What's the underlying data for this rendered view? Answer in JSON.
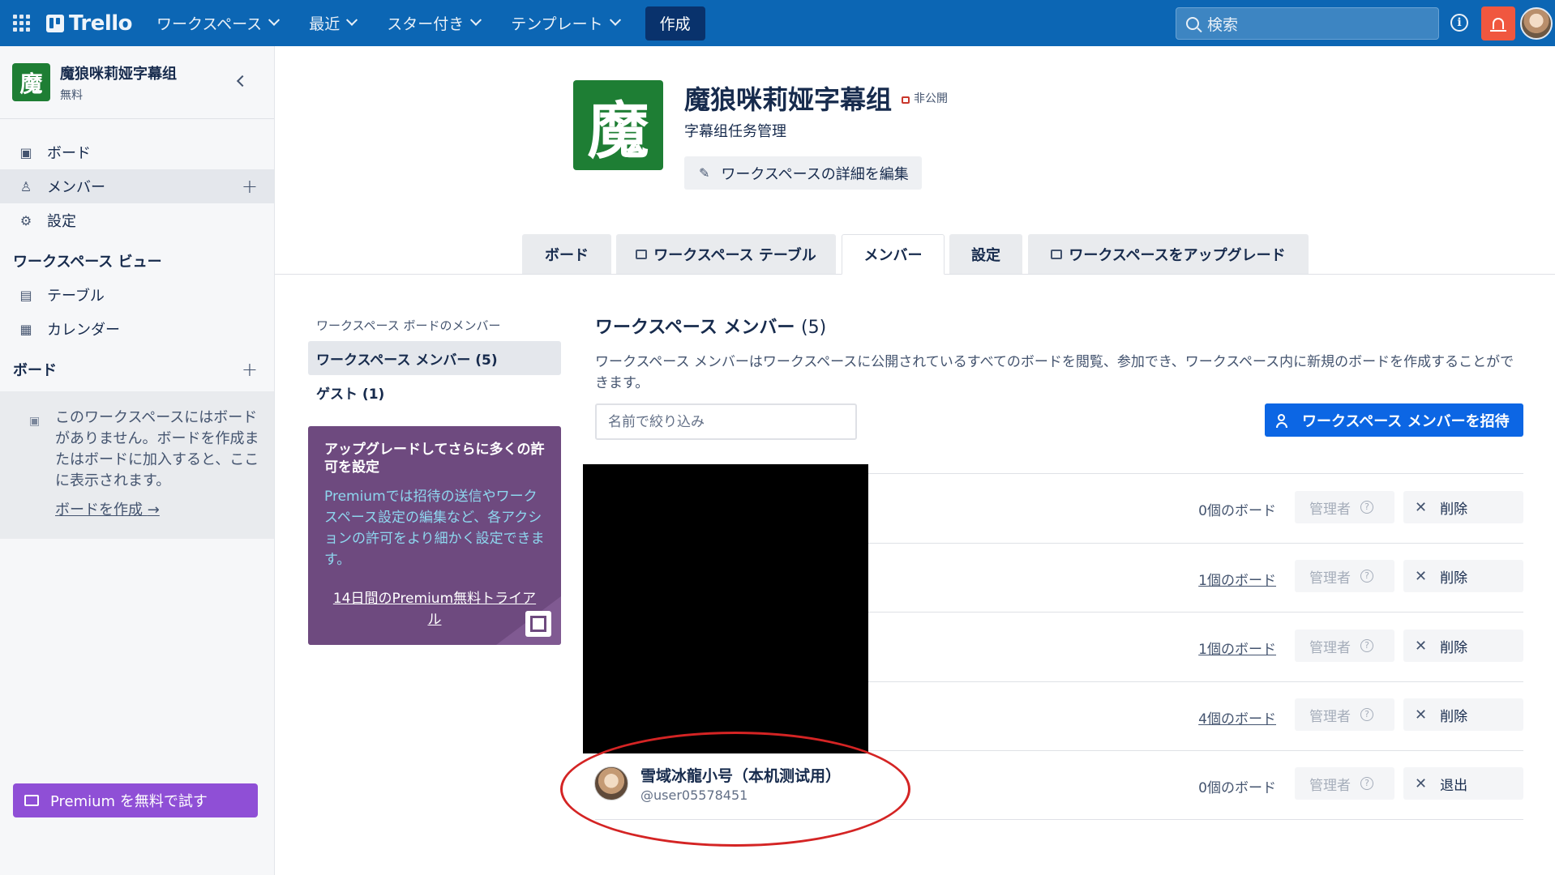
{
  "topnav": {
    "logo": "Trello",
    "menus": [
      "ワークスペース",
      "最近",
      "スター付き",
      "テンプレート"
    ],
    "create": "作成",
    "search_placeholder": "検索"
  },
  "sidebar": {
    "ws_initial": "魔",
    "ws_name": "魔狼咪莉娅字幕组",
    "ws_plan": "無料",
    "items": [
      {
        "label": "ボード"
      },
      {
        "label": "メンバー"
      },
      {
        "label": "設定"
      }
    ],
    "views_heading": "ワークスペース ビュー",
    "views": [
      {
        "label": "テーブル"
      },
      {
        "label": "カレンダー"
      }
    ],
    "boards_heading": "ボード",
    "empty_text": "このワークスペースにはボードがありません。ボードを作成またはボードに加入すると、ここに表示されます。",
    "create_board_link": "ボードを作成",
    "premium_button": "Premium を無料で試す"
  },
  "workspace": {
    "initial": "魔",
    "title": "魔狼咪莉娅字幕组",
    "visibility": "非公開",
    "description": "字幕组任务管理",
    "edit_button": "ワークスペースの詳細を編集"
  },
  "tabs": [
    "ボード",
    "ワークスペース テーブル",
    "メンバー",
    "設定",
    "ワークスペースをアップグレード"
  ],
  "member_nav": {
    "heading": "ワークスペース ボードのメンバー",
    "items": [
      "ワークスペース メンバー (5)",
      "ゲスト (1)"
    ]
  },
  "upgrade_card": {
    "title": "アップグレードしてさらに多くの許可を設定",
    "body": "Premiumでは招待の送信やワークスペース設定の編集など、各アクションの許可をより細かく設定できます。",
    "trial_link": "14日間のPremium無料トライアル"
  },
  "members_panel": {
    "title": "ワークスペース メンバー",
    "count": "(5)",
    "description": "ワークスペース メンバーはワークスペースに公開されているすべてのボードを閲覧、参加でき、ワークスペース内に新規のボードを作成することができます。",
    "filter_placeholder": "名前で絞り込み",
    "invite_button": "ワークスペース メンバーを招待",
    "rows": [
      {
        "boards": "0個のボード",
        "role": "管理者",
        "action": "削除"
      },
      {
        "boards": "1個のボード",
        "role": "管理者",
        "action": "削除"
      },
      {
        "boards": "1個のボード",
        "role": "管理者",
        "action": "削除"
      },
      {
        "boards": "4個のボード",
        "role": "管理者",
        "action": "削除"
      },
      {
        "name": "雪域冰龍小号（本机测试用）",
        "username": "@user05578451",
        "boards": "0個のボード",
        "role": "管理者",
        "action": "退出"
      }
    ]
  }
}
